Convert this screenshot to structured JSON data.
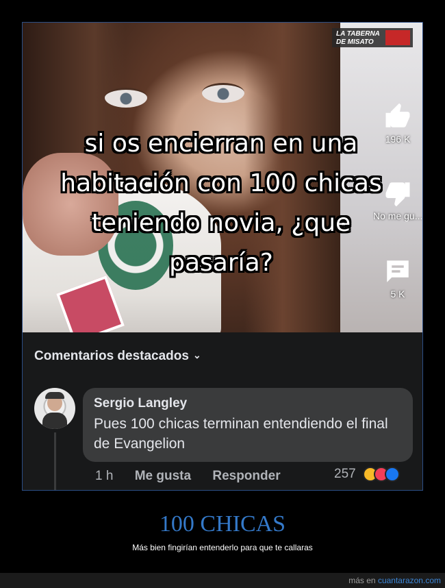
{
  "video": {
    "caption_lines": [
      "si os encierran en una",
      "habitación con 100 chicas",
      "teniendo novia, ¿que",
      "pasaría?"
    ],
    "watermark": {
      "line1": "LA TABERNA",
      "line2": "DE MISATO"
    },
    "likes": "196 K",
    "dislike_label": "No me gu...",
    "comments_count": "5 K"
  },
  "comments": {
    "header": "Comentarios destacados",
    "items": [
      {
        "author": "Sergio Langley",
        "text": "Pues 100 chicas terminan entendiendo el final de Evangelion",
        "time": "1 h",
        "like_action": "Me gusta",
        "reply_action": "Responder",
        "reaction_count": "257"
      }
    ]
  },
  "post": {
    "title": "100 CHICAS",
    "subtitle": "Más bien fingirían entenderlo para que te callaras"
  },
  "footer": {
    "more_prefix": "más en",
    "site": "cuantarazon.com"
  },
  "colors": {
    "title_blue": "#3479c9",
    "link_blue": "#3d87d8",
    "card_bg": "#18191a",
    "bubble_bg": "#3a3b3c"
  }
}
